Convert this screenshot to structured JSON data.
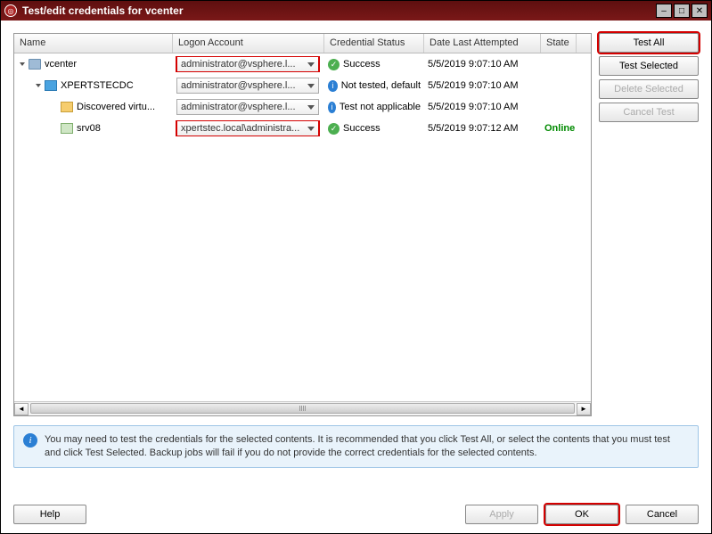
{
  "window": {
    "title": "Test/edit credentials for vcenter"
  },
  "columns": {
    "name": "Name",
    "logon": "Logon Account",
    "status": "Credential Status",
    "date": "Date Last Attempted",
    "state": "State"
  },
  "rows": [
    {
      "indent": 0,
      "toggle": "open",
      "icon": "vcenter-icon",
      "name": "vcenter",
      "logon": "administrator@vsphere.l...",
      "logon_hl": true,
      "status_kind": "success",
      "status": "Success",
      "date": "5/5/2019 9:07:10 AM",
      "state": ""
    },
    {
      "indent": 1,
      "toggle": "open",
      "icon": "datacenter-icon",
      "name": "XPERTSTECDC",
      "logon": "administrator@vsphere.l...",
      "logon_hl": false,
      "status_kind": "info",
      "status": "Not tested, default",
      "date": "5/5/2019 9:07:10 AM",
      "state": ""
    },
    {
      "indent": 2,
      "toggle": "",
      "icon": "folder-icon",
      "name": "Discovered virtu...",
      "logon": "administrator@vsphere.l...",
      "logon_hl": false,
      "status_kind": "info",
      "status": "Test not applicable",
      "date": "5/5/2019 9:07:10 AM",
      "state": ""
    },
    {
      "indent": 2,
      "toggle": "",
      "icon": "host-icon",
      "name": "srv08",
      "logon": "xpertstec.local\\administra...",
      "logon_hl": true,
      "status_kind": "success",
      "status": "Success",
      "date": "5/5/2019 9:07:12 AM",
      "state": "Online"
    }
  ],
  "side_buttons": {
    "test_all": "Test All",
    "test_selected": "Test Selected",
    "delete_selected": "Delete Selected",
    "cancel_test": "Cancel Test"
  },
  "info": "You may need to test the credentials for the selected contents. It is recommended that you click Test All, or select the contents that you must test and click Test Selected. Backup jobs will fail if you do not provide the correct credentials for the selected contents.",
  "footer": {
    "help": "Help",
    "apply": "Apply",
    "ok": "OK",
    "cancel": "Cancel"
  }
}
